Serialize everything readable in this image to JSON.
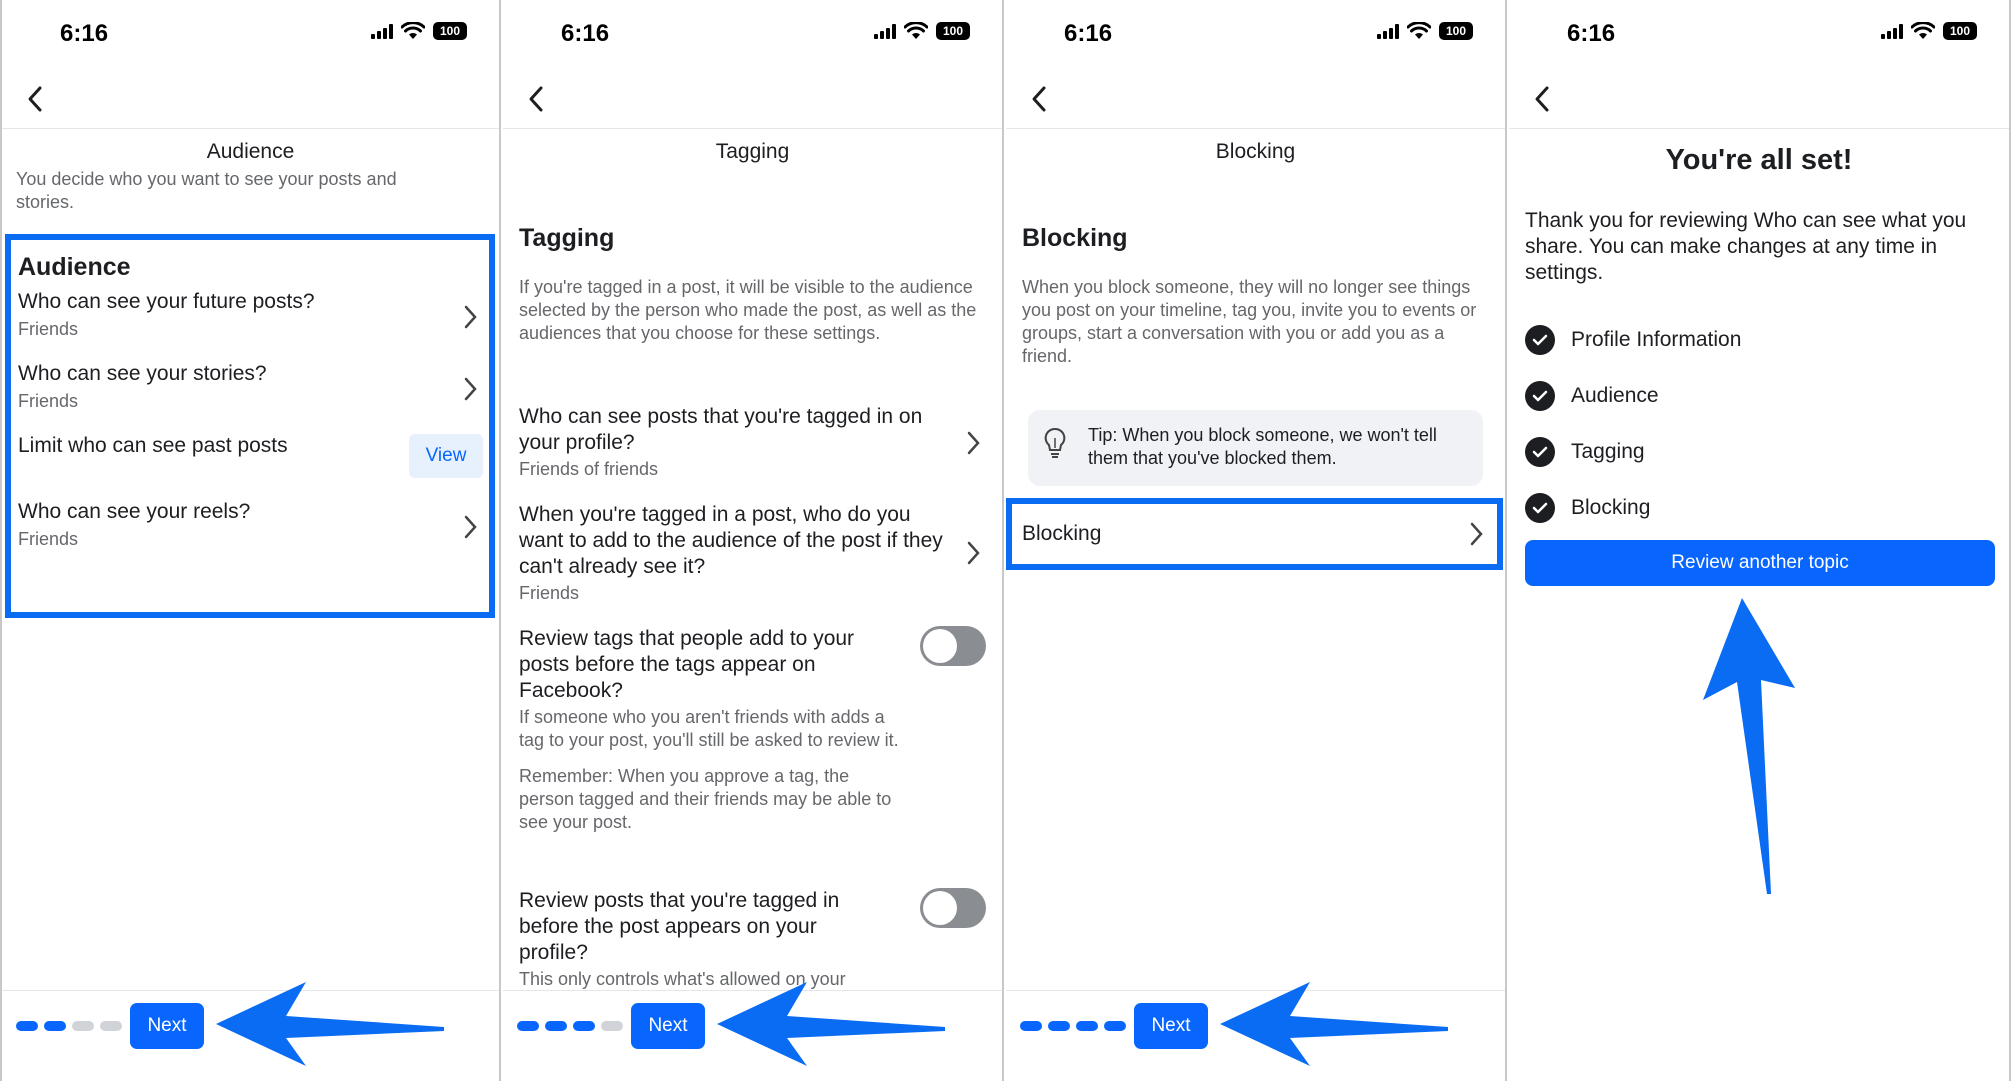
{
  "status": {
    "time": "6:16",
    "battery": "100"
  },
  "panels": {
    "audience": {
      "header": "Audience",
      "intro": "You decide who you want to see your posts and stories.",
      "section_title": "Audience",
      "items": [
        {
          "title": "Who can see your future posts?",
          "value": "Friends"
        },
        {
          "title": "Who can see your stories?",
          "value": "Friends"
        },
        {
          "title": "Limit who can see past posts",
          "action": "View"
        },
        {
          "title": "Who can see your reels?",
          "value": "Friends"
        }
      ],
      "next_label": "Next"
    },
    "tagging": {
      "header": "Tagging",
      "section_title": "Tagging",
      "intro": "If you're tagged in a post, it will be visible to the audience selected by the person who made the post, as well as the audiences that you choose for these settings.",
      "items": [
        {
          "title": "Who can see posts that you're tagged in on your profile?",
          "value": "Friends of friends"
        },
        {
          "title": "When you're tagged in a post, who do you want to add to the audience of the post if they can't already see it?",
          "value": "Friends"
        }
      ],
      "toggles": [
        {
          "title": "Review tags that people add to your posts before the tags appear on Facebook?",
          "desc": "If someone who you aren't friends with adds a tag to your post, you'll still be asked to review it.",
          "note": "Remember: When you approve a tag, the person tagged and their friends may be able to see your post."
        },
        {
          "title": "Review posts that you're tagged in before the post appears on your profile?",
          "desc": "This only controls what's allowed on your"
        }
      ],
      "next_label": "Next"
    },
    "blocking": {
      "header": "Blocking",
      "section_title": "Blocking",
      "intro": "When you block someone, they will no longer see things you post on your timeline, tag you, invite you to events or groups, start a conversation with you or add you as a friend.",
      "tip": "Tip: When you block someone, we won't tell them that you've blocked them.",
      "row_label": "Blocking",
      "next_label": "Next"
    },
    "done": {
      "title": "You're all set!",
      "body": "Thank you for reviewing Who can see what you share. You can make changes at any time in settings.",
      "checklist": [
        "Profile Information",
        "Audience",
        "Tagging",
        "Blocking"
      ],
      "button": "Review another topic"
    }
  },
  "colors": {
    "accent": "#0866ff",
    "highlight": "#0a6cf2",
    "toggle_off": "#8a8d91"
  }
}
